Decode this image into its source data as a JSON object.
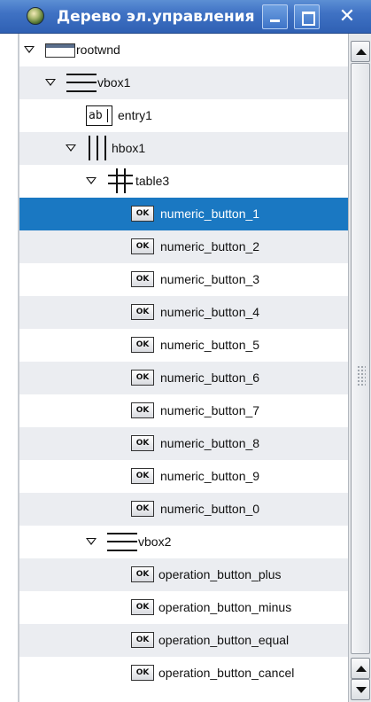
{
  "window": {
    "title": "Дерево эл.управления",
    "app_icon": "gear-globe-icon",
    "close_glyph": "✕"
  },
  "tree": {
    "nodes": [
      {
        "label": "rootwnd",
        "icon": "window-icon",
        "expanded": true,
        "selected": false
      },
      {
        "label": "vbox1",
        "icon": "vbox-icon",
        "expanded": true,
        "selected": false
      },
      {
        "label": "entry1",
        "icon": "entry-icon",
        "icon_text": "ab",
        "selected": false
      },
      {
        "label": "hbox1",
        "icon": "hbox-icon",
        "expanded": true,
        "selected": false
      },
      {
        "label": "table3",
        "icon": "table-icon",
        "expanded": true,
        "selected": false
      },
      {
        "label": "numeric_button_1",
        "icon": "ok-button-icon",
        "icon_text": "OK",
        "selected": true
      },
      {
        "label": "numeric_button_2",
        "icon": "ok-button-icon",
        "icon_text": "OK",
        "selected": false
      },
      {
        "label": "numeric_button_3",
        "icon": "ok-button-icon",
        "icon_text": "OK",
        "selected": false
      },
      {
        "label": "numeric_button_4",
        "icon": "ok-button-icon",
        "icon_text": "OK",
        "selected": false
      },
      {
        "label": "numeric_button_5",
        "icon": "ok-button-icon",
        "icon_text": "OK",
        "selected": false
      },
      {
        "label": "numeric_button_6",
        "icon": "ok-button-icon",
        "icon_text": "OK",
        "selected": false
      },
      {
        "label": "numeric_button_7",
        "icon": "ok-button-icon",
        "icon_text": "OK",
        "selected": false
      },
      {
        "label": "numeric_button_8",
        "icon": "ok-button-icon",
        "icon_text": "OK",
        "selected": false
      },
      {
        "label": "numeric_button_9",
        "icon": "ok-button-icon",
        "icon_text": "OK",
        "selected": false
      },
      {
        "label": "numeric_button_0",
        "icon": "ok-button-icon",
        "icon_text": "OK",
        "selected": false
      },
      {
        "label": "vbox2",
        "icon": "vbox-icon",
        "expanded": true,
        "selected": false
      },
      {
        "label": "operation_button_plus",
        "icon": "ok-button-icon",
        "icon_text": "OK",
        "selected": false
      },
      {
        "label": "operation_button_minus",
        "icon": "ok-button-icon",
        "icon_text": "OK",
        "selected": false
      },
      {
        "label": "operation_button_equal",
        "icon": "ok-button-icon",
        "icon_text": "OK",
        "selected": false
      },
      {
        "label": "operation_button_cancel",
        "icon": "ok-button-icon",
        "icon_text": "OK",
        "selected": false
      }
    ]
  },
  "colors": {
    "titlebar": "#3f72c4",
    "selection": "#1a78c2",
    "alt_row": "#ebedf1"
  }
}
